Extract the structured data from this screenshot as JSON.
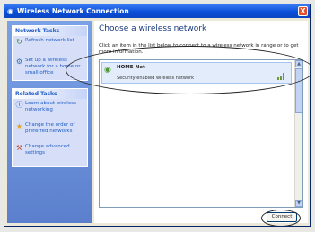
{
  "window": {
    "title": "Wireless Network Connection",
    "close_glyph": "X"
  },
  "sidebar": {
    "network_tasks": {
      "header": "Network Tasks",
      "items": [
        {
          "label": "Refresh network list",
          "icon": "refresh-icon"
        },
        {
          "label": "Set up a wireless network for a home or small office",
          "icon": "setup-network-icon"
        }
      ]
    },
    "related_tasks": {
      "header": "Related Tasks",
      "items": [
        {
          "label": "Learn about wireless networking",
          "icon": "info-icon"
        },
        {
          "label": "Change the order of preferred networks",
          "icon": "star-icon"
        },
        {
          "label": "Change advanced settings",
          "icon": "settings-icon"
        }
      ]
    }
  },
  "main": {
    "heading": "Choose a wireless network",
    "instructions": "Click an item in the list below to connect to a wireless network in range or to get more information.",
    "networks": [
      {
        "name": "HOME-Net",
        "security": "Security-enabled wireless network",
        "signal": 3
      }
    ],
    "connect_button": "Connect"
  }
}
